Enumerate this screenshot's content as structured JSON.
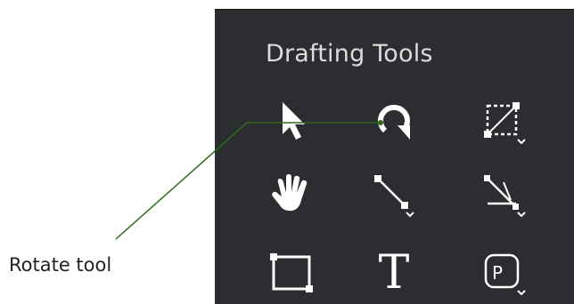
{
  "panel": {
    "title": "Drafting Tools",
    "background": "#2b2d31",
    "icon_color": "#ffffff",
    "tools": [
      {
        "icon": "arrow-select-icon",
        "label": "Select"
      },
      {
        "icon": "rotate-icon",
        "label": "Rotate"
      },
      {
        "icon": "crop-scale-icon",
        "label": "Scale"
      },
      {
        "icon": "hand-pan-icon",
        "label": "Pan"
      },
      {
        "icon": "line-icon",
        "label": "Line"
      },
      {
        "icon": "angle-dimension-icon",
        "label": "Dimension"
      },
      {
        "icon": "rectangle-icon",
        "label": "Rectangle"
      },
      {
        "icon": "text-icon",
        "label": "Text",
        "glyph": "T"
      },
      {
        "icon": "parking-p-icon",
        "label": "P",
        "glyph": "P"
      }
    ]
  },
  "callout": {
    "label": "Rotate tool",
    "line_color": "#2e6b1c"
  }
}
